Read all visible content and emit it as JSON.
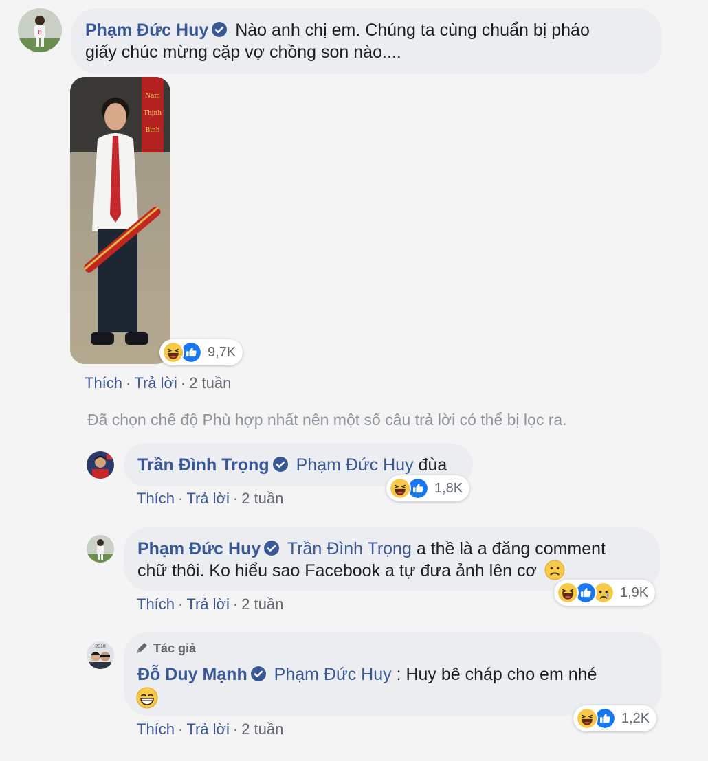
{
  "comment": {
    "author": "Phạm Đức Huy",
    "text_line1": "Nào anh chị em. Chúng ta cùng chuẩn bị pháo",
    "text_line2": "giấy chúc mừng cặp vợ chồng son nào....",
    "reaction_count": "9,7K",
    "actions": {
      "like": "Thích",
      "reply": "Trả lời",
      "time": "2 tuần"
    }
  },
  "filter_notice": "Đã chọn chế độ Phù hợp nhất nên một số câu trả lời có thể bị lọc ra.",
  "replies": [
    {
      "author": "Trần Đình Trọng",
      "mention": "Phạm Đức Huy",
      "text": "đùa",
      "reaction_count": "1,8K",
      "actions": {
        "like": "Thích",
        "reply": "Trả lời",
        "time": "2 tuần"
      }
    },
    {
      "author": "Phạm Đức Huy",
      "mention": "Trần Đình Trọng",
      "text_line1": "a thề là a đăng comment",
      "text_line2": "chữ thôi. Ko hiểu sao Facebook a tự đưa ảnh lên cơ",
      "reaction_count": "1,9K",
      "actions": {
        "like": "Thích",
        "reply": "Trả lời",
        "time": "2 tuần"
      }
    },
    {
      "badge": "Tác giả",
      "author": "Đỗ Duy Mạnh",
      "mention": "Phạm Đức Huy",
      "text": ": Huy bê cháp cho em nhé",
      "reaction_count": "1,2K",
      "actions": {
        "like": "Thích",
        "reply": "Trả lời",
        "time": "2 tuần"
      }
    }
  ],
  "colors": {
    "link": "#385898",
    "bubble": "#ebedf0",
    "meta": "#606770",
    "like_blue": "#1877f2",
    "haha_yellow": "#f7c948"
  },
  "icons": [
    "verified-badge-icon",
    "haha-reaction-icon",
    "like-reaction-icon",
    "sad-reaction-icon",
    "pen-icon",
    "sad-emoji-icon",
    "grin-emoji-icon"
  ]
}
